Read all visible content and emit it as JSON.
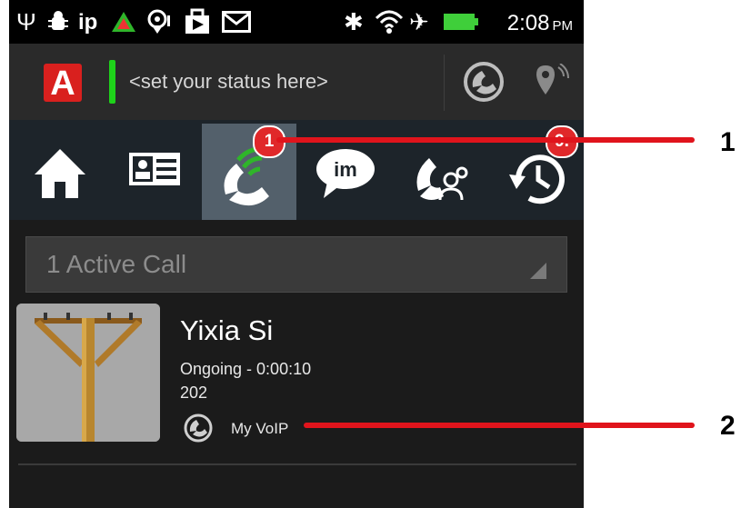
{
  "status_bar": {
    "icons": [
      "usb-icon",
      "android-debug-icon",
      "ip-label",
      "warning-triangle-icon",
      "location-pin-icon",
      "download-bag-icon",
      "mail-icon",
      "bluetooth-icon",
      "wifi-icon",
      "airplane-icon",
      "battery-icon"
    ],
    "ip_text": "ip",
    "time": "2:08",
    "ampm": "PM"
  },
  "header": {
    "logo_letter": "A",
    "status_placeholder": "<set your status here>"
  },
  "tabs": [
    {
      "name": "home"
    },
    {
      "name": "contacts"
    },
    {
      "name": "calls",
      "badge": "1",
      "active": true
    },
    {
      "name": "im",
      "icon_text": "im"
    },
    {
      "name": "conference"
    },
    {
      "name": "history",
      "badge": "9."
    }
  ],
  "active_calls": {
    "label": "1 Active Call"
  },
  "call": {
    "name": "Yixia Si",
    "status": "Ongoing - 0:00:10",
    "number": "202",
    "account": "My VoIP"
  },
  "annotations": [
    {
      "number": "1"
    },
    {
      "number": "2"
    }
  ],
  "colors": {
    "accent_red": "#e0141c",
    "logo_red": "#d9201e",
    "presence_green": "#1ed21a",
    "tab_active": "#53606b"
  }
}
